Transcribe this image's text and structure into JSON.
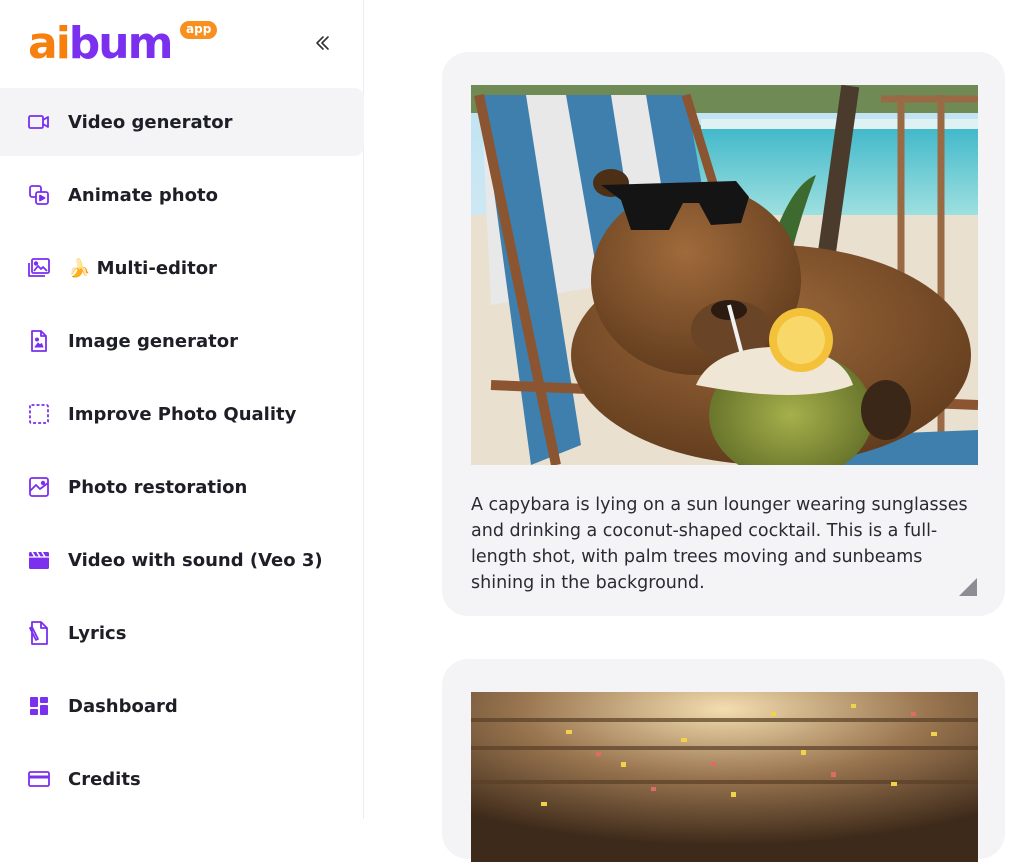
{
  "brand": {
    "logo_a": "ai",
    "logo_rest": "bum",
    "logo_badge": "app"
  },
  "sidebar": {
    "collapse_icon": "double-chevron-left-icon",
    "items": [
      {
        "label": "Video generator",
        "icon": "video-camera-icon",
        "active": true
      },
      {
        "label": "Animate photo",
        "icon": "animate-photo-icon"
      },
      {
        "label": "🍌 Multi-editor",
        "icon": "images-stack-icon"
      },
      {
        "label": "Image generator",
        "icon": "image-file-icon"
      },
      {
        "label": "Improve Photo Quality",
        "icon": "enhance-photo-icon"
      },
      {
        "label": "Photo restoration",
        "icon": "photo-restore-icon"
      },
      {
        "label": "Video with sound (Veo 3)",
        "icon": "clapperboard-icon"
      },
      {
        "label": "Lyrics",
        "icon": "lyrics-file-icon"
      },
      {
        "label": "Dashboard",
        "icon": "dashboard-grid-icon"
      },
      {
        "label": "Credits",
        "icon": "credit-card-icon"
      }
    ]
  },
  "feed": {
    "cards": [
      {
        "prompt": "A capybara is lying on a sun lounger wearing sunglasses and drinking a coconut-shaped cocktail. This is a full-length shot, with palm trees moving and sunbeams shining in the background."
      }
    ]
  },
  "colors": {
    "accent": "#7b2fef",
    "orange": "#f77f0e",
    "card_bg": "#f4f4f6"
  }
}
